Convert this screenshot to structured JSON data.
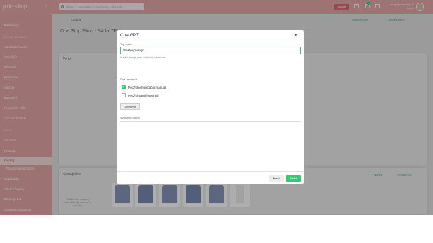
{
  "topbar": {
    "logo_main": "prim",
    "logo_sub": "shop",
    "search_placeholder": "Hledat v administraci, objednávky, zákazníky...",
    "upgrade_label": "Upgrade",
    "notification_count": "3",
    "user_email": "eshop@primshop.cz",
    "user_role": "Admin"
  },
  "sidebar": {
    "items": [
      {
        "label": "Dashboard"
      },
      {
        "label": "Struktura v obsah"
      },
      {
        "label": "Formuláře"
      },
      {
        "label": "Uživatelé"
      },
      {
        "label": "Rezervace"
      },
      {
        "label": "Šablony"
      },
      {
        "label": "Nastavení"
      },
      {
        "label": "Pravidelné e-šíle"
      },
      {
        "label": "Činnost uživatelů"
      },
      {
        "label": "Struktura"
      },
      {
        "label": "Produkty"
      },
      {
        "label": "Katalog"
      },
      {
        "label": "Produktové parametry"
      },
      {
        "label": "Objednávky"
      },
      {
        "label": "Slevové kupóny"
      },
      {
        "label": "Měna a jazyk"
      },
      {
        "label": "Skladová dostupnost"
      }
    ],
    "sections": [
      "NASTAVENÍ WEBU",
      "ESHOP"
    ]
  },
  "background": {
    "breadcrumb": "Katalog",
    "product_title": "One Stop Shop - Sada DPH",
    "section_perex": "Perex",
    "section_media": "Mediaplatce",
    "media_placeholder": "Přetáhněte soubory sem, klikněte sem nebo použijte",
    "add_media": "+ Nahrát",
    "add_url": "+ Vložit URL",
    "top_action_1": "Uložit změny",
    "top_action_2": "Uložit a zavřít"
  },
  "modal": {
    "title": "ChatGPT",
    "close_icon": "close-icon",
    "type_label": "Typ dotazu",
    "type_value": "Vlastní prompt",
    "type_help": "Vlastní prompt nebo doplňující informace.",
    "options_label": "Další možnosti",
    "options": [
      {
        "label": "Použít komunikační manuál",
        "checked": true
      },
      {
        "label": "Použít hlavní fotografii",
        "checked": false
      }
    ],
    "generate_label": "Generovat",
    "result_label": "Výsledek dotazu",
    "close_label": "Zavřít",
    "insert_label": "Vložit"
  },
  "colors": {
    "brand": "#e6a1a1",
    "accent_green": "#2ecc71",
    "upgrade_red": "#e25b6b"
  }
}
